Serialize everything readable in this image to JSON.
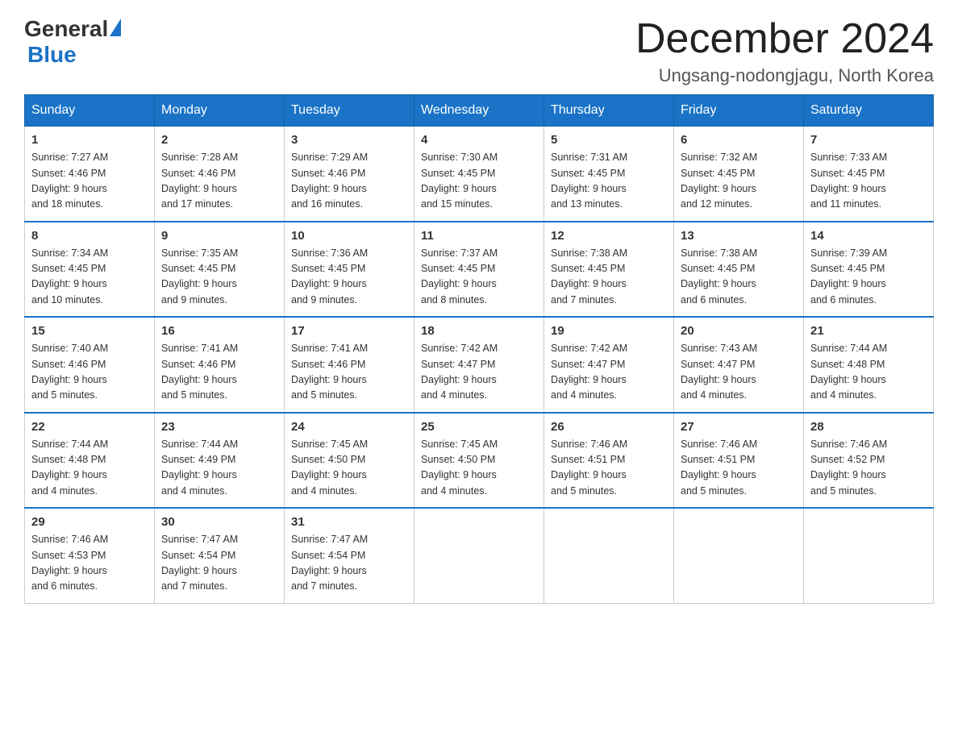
{
  "header": {
    "logo_general": "General",
    "logo_blue": "Blue",
    "month_title": "December 2024",
    "location": "Ungsang-nodongjagu, North Korea"
  },
  "days_of_week": [
    "Sunday",
    "Monday",
    "Tuesday",
    "Wednesday",
    "Thursday",
    "Friday",
    "Saturday"
  ],
  "weeks": [
    [
      {
        "day": "1",
        "sunrise": "7:27 AM",
        "sunset": "4:46 PM",
        "daylight": "9 hours and 18 minutes."
      },
      {
        "day": "2",
        "sunrise": "7:28 AM",
        "sunset": "4:46 PM",
        "daylight": "9 hours and 17 minutes."
      },
      {
        "day": "3",
        "sunrise": "7:29 AM",
        "sunset": "4:46 PM",
        "daylight": "9 hours and 16 minutes."
      },
      {
        "day": "4",
        "sunrise": "7:30 AM",
        "sunset": "4:45 PM",
        "daylight": "9 hours and 15 minutes."
      },
      {
        "day": "5",
        "sunrise": "7:31 AM",
        "sunset": "4:45 PM",
        "daylight": "9 hours and 13 minutes."
      },
      {
        "day": "6",
        "sunrise": "7:32 AM",
        "sunset": "4:45 PM",
        "daylight": "9 hours and 12 minutes."
      },
      {
        "day": "7",
        "sunrise": "7:33 AM",
        "sunset": "4:45 PM",
        "daylight": "9 hours and 11 minutes."
      }
    ],
    [
      {
        "day": "8",
        "sunrise": "7:34 AM",
        "sunset": "4:45 PM",
        "daylight": "9 hours and 10 minutes."
      },
      {
        "day": "9",
        "sunrise": "7:35 AM",
        "sunset": "4:45 PM",
        "daylight": "9 hours and 9 minutes."
      },
      {
        "day": "10",
        "sunrise": "7:36 AM",
        "sunset": "4:45 PM",
        "daylight": "9 hours and 9 minutes."
      },
      {
        "day": "11",
        "sunrise": "7:37 AM",
        "sunset": "4:45 PM",
        "daylight": "9 hours and 8 minutes."
      },
      {
        "day": "12",
        "sunrise": "7:38 AM",
        "sunset": "4:45 PM",
        "daylight": "9 hours and 7 minutes."
      },
      {
        "day": "13",
        "sunrise": "7:38 AM",
        "sunset": "4:45 PM",
        "daylight": "9 hours and 6 minutes."
      },
      {
        "day": "14",
        "sunrise": "7:39 AM",
        "sunset": "4:45 PM",
        "daylight": "9 hours and 6 minutes."
      }
    ],
    [
      {
        "day": "15",
        "sunrise": "7:40 AM",
        "sunset": "4:46 PM",
        "daylight": "9 hours and 5 minutes."
      },
      {
        "day": "16",
        "sunrise": "7:41 AM",
        "sunset": "4:46 PM",
        "daylight": "9 hours and 5 minutes."
      },
      {
        "day": "17",
        "sunrise": "7:41 AM",
        "sunset": "4:46 PM",
        "daylight": "9 hours and 5 minutes."
      },
      {
        "day": "18",
        "sunrise": "7:42 AM",
        "sunset": "4:47 PM",
        "daylight": "9 hours and 4 minutes."
      },
      {
        "day": "19",
        "sunrise": "7:42 AM",
        "sunset": "4:47 PM",
        "daylight": "9 hours and 4 minutes."
      },
      {
        "day": "20",
        "sunrise": "7:43 AM",
        "sunset": "4:47 PM",
        "daylight": "9 hours and 4 minutes."
      },
      {
        "day": "21",
        "sunrise": "7:44 AM",
        "sunset": "4:48 PM",
        "daylight": "9 hours and 4 minutes."
      }
    ],
    [
      {
        "day": "22",
        "sunrise": "7:44 AM",
        "sunset": "4:48 PM",
        "daylight": "9 hours and 4 minutes."
      },
      {
        "day": "23",
        "sunrise": "7:44 AM",
        "sunset": "4:49 PM",
        "daylight": "9 hours and 4 minutes."
      },
      {
        "day": "24",
        "sunrise": "7:45 AM",
        "sunset": "4:50 PM",
        "daylight": "9 hours and 4 minutes."
      },
      {
        "day": "25",
        "sunrise": "7:45 AM",
        "sunset": "4:50 PM",
        "daylight": "9 hours and 4 minutes."
      },
      {
        "day": "26",
        "sunrise": "7:46 AM",
        "sunset": "4:51 PM",
        "daylight": "9 hours and 5 minutes."
      },
      {
        "day": "27",
        "sunrise": "7:46 AM",
        "sunset": "4:51 PM",
        "daylight": "9 hours and 5 minutes."
      },
      {
        "day": "28",
        "sunrise": "7:46 AM",
        "sunset": "4:52 PM",
        "daylight": "9 hours and 5 minutes."
      }
    ],
    [
      {
        "day": "29",
        "sunrise": "7:46 AM",
        "sunset": "4:53 PM",
        "daylight": "9 hours and 6 minutes."
      },
      {
        "day": "30",
        "sunrise": "7:47 AM",
        "sunset": "4:54 PM",
        "daylight": "9 hours and 7 minutes."
      },
      {
        "day": "31",
        "sunrise": "7:47 AM",
        "sunset": "4:54 PM",
        "daylight": "9 hours and 7 minutes."
      },
      null,
      null,
      null,
      null
    ]
  ],
  "labels": {
    "sunrise": "Sunrise:",
    "sunset": "Sunset:",
    "daylight": "Daylight:"
  }
}
